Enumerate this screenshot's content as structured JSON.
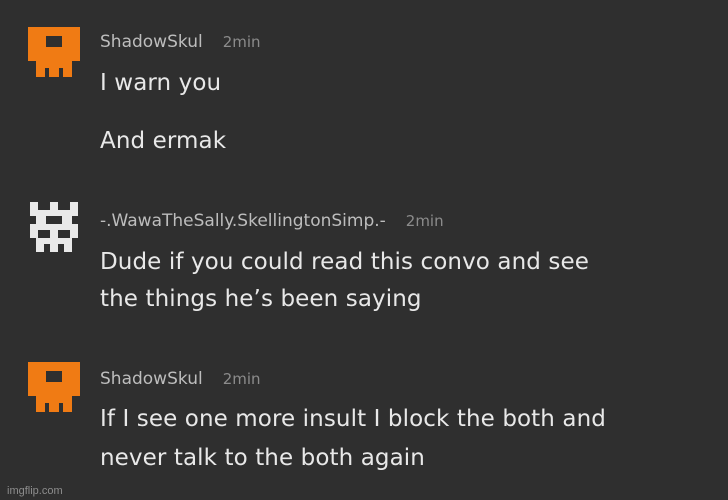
{
  "messages": [
    {
      "username": "ShadowSkul",
      "time": "2min",
      "avatar_icon": "orange-pixel-skull-icon",
      "avatar_color": "#f07b14",
      "lines": [
        "I warn you",
        "And ermak"
      ]
    },
    {
      "username": "-.WawaTheSally.SkellingtonSimp.-",
      "time": "2min",
      "avatar_icon": "white-pixel-skull-icon",
      "avatar_color": "#e9e9e9",
      "lines": [
        "Dude if you could read this convo and see",
        "the things he’s been saying"
      ]
    },
    {
      "username": "ShadowSkul",
      "time": "2min",
      "avatar_icon": "orange-pixel-skull-icon",
      "avatar_color": "#f07b14",
      "lines": [
        "If I see one more insult I block the both and",
        "never talk to the both again"
      ]
    }
  ],
  "watermark": "imgflip.com",
  "colors": {
    "background": "#2f2f2f",
    "text": "#e8e8e8",
    "username": "#bdbdbd",
    "timestamp": "#8c8c8c"
  }
}
